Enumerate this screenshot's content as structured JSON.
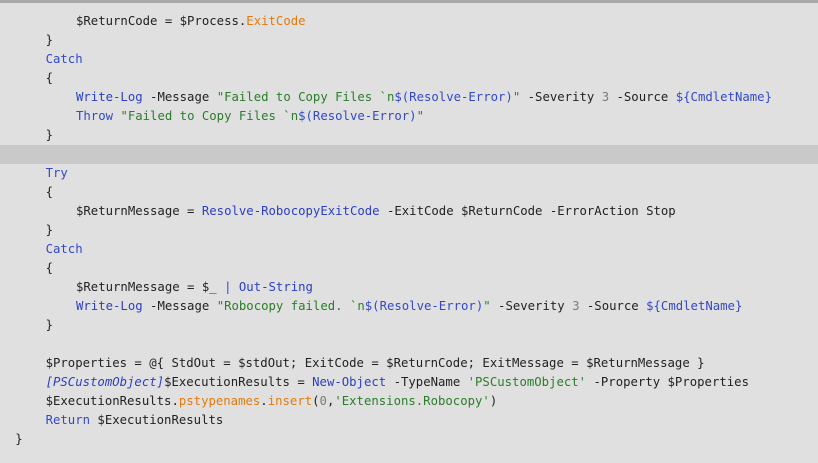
{
  "lines": [
    {
      "indent": 10,
      "tokens": [
        [
          "var",
          "$ReturnCode"
        ],
        [
          "plain",
          " = "
        ],
        [
          "var",
          "$Process"
        ],
        [
          "plain",
          "."
        ],
        [
          "prop",
          "ExitCode"
        ]
      ]
    },
    {
      "indent": 6,
      "tokens": [
        [
          "punc",
          "}"
        ]
      ]
    },
    {
      "indent": 6,
      "tokens": [
        [
          "kw",
          "Catch"
        ]
      ]
    },
    {
      "indent": 6,
      "tokens": [
        [
          "punc",
          "{"
        ]
      ]
    },
    {
      "indent": 10,
      "tokens": [
        [
          "cmd",
          "Write-Log"
        ],
        [
          "param",
          " -Message "
        ],
        [
          "str",
          "\"Failed to Copy Files `n"
        ],
        [
          "kw",
          "$(Resolve-Error)"
        ],
        [
          "str",
          "\""
        ],
        [
          "param",
          " -Severity "
        ],
        [
          "num",
          "3"
        ],
        [
          "param",
          " -Source "
        ],
        [
          "kw",
          "${CmdletName}"
        ]
      ]
    },
    {
      "indent": 10,
      "tokens": [
        [
          "kw",
          "Throw"
        ],
        [
          "plain",
          " "
        ],
        [
          "str",
          "\"Failed to Copy Files `n"
        ],
        [
          "kw",
          "$(Resolve-Error)"
        ],
        [
          "str",
          "\""
        ]
      ]
    },
    {
      "indent": 6,
      "tokens": [
        [
          "punc",
          "}"
        ]
      ]
    },
    {
      "indent": 0,
      "highlight": true,
      "tokens": []
    },
    {
      "indent": 6,
      "tokens": [
        [
          "kw",
          "Try"
        ]
      ]
    },
    {
      "indent": 6,
      "tokens": [
        [
          "punc",
          "{"
        ]
      ]
    },
    {
      "indent": 10,
      "tokens": [
        [
          "var",
          "$ReturnMessage"
        ],
        [
          "plain",
          " = "
        ],
        [
          "cmd",
          "Resolve-RobocopyExitCode"
        ],
        [
          "param",
          " -ExitCode "
        ],
        [
          "var",
          "$ReturnCode"
        ],
        [
          "param",
          " -ErrorAction "
        ],
        [
          "plain",
          "Stop"
        ]
      ]
    },
    {
      "indent": 6,
      "tokens": [
        [
          "punc",
          "}"
        ]
      ]
    },
    {
      "indent": 6,
      "tokens": [
        [
          "kw",
          "Catch"
        ]
      ]
    },
    {
      "indent": 6,
      "tokens": [
        [
          "punc",
          "{"
        ]
      ]
    },
    {
      "indent": 10,
      "tokens": [
        [
          "var",
          "$ReturnMessage"
        ],
        [
          "plain",
          " = "
        ],
        [
          "var",
          "$_"
        ],
        [
          "plain",
          " "
        ],
        [
          "op",
          "|"
        ],
        [
          "plain",
          " "
        ],
        [
          "cmd",
          "Out-String"
        ]
      ]
    },
    {
      "indent": 10,
      "tokens": [
        [
          "cmd",
          "Write-Log"
        ],
        [
          "param",
          " -Message "
        ],
        [
          "str",
          "\"Robocopy failed. `n"
        ],
        [
          "kw",
          "$(Resolve-Error)"
        ],
        [
          "str",
          "\""
        ],
        [
          "param",
          " -Severity "
        ],
        [
          "num",
          "3"
        ],
        [
          "param",
          " -Source "
        ],
        [
          "kw",
          "${CmdletName}"
        ]
      ]
    },
    {
      "indent": 6,
      "tokens": [
        [
          "punc",
          "}"
        ]
      ]
    },
    {
      "indent": 0,
      "tokens": []
    },
    {
      "indent": 6,
      "tokens": [
        [
          "var",
          "$Properties"
        ],
        [
          "plain",
          " = "
        ],
        [
          "plain",
          "@{ StdOut = "
        ],
        [
          "var",
          "$stdOut"
        ],
        [
          "plain",
          "; ExitCode = "
        ],
        [
          "var",
          "$ReturnCode"
        ],
        [
          "plain",
          "; ExitMessage = "
        ],
        [
          "var",
          "$ReturnMessage"
        ],
        [
          "plain",
          " }"
        ]
      ]
    },
    {
      "indent": 6,
      "tokens": [
        [
          "type",
          "[PSCustomObject]"
        ],
        [
          "var",
          "$ExecutionResults"
        ],
        [
          "plain",
          " = "
        ],
        [
          "cmd",
          "New-Object"
        ],
        [
          "param",
          " -TypeName "
        ],
        [
          "str",
          "'PSCustomObject'"
        ],
        [
          "param",
          " -Property "
        ],
        [
          "var",
          "$Properties"
        ]
      ]
    },
    {
      "indent": 6,
      "tokens": [
        [
          "var",
          "$ExecutionResults"
        ],
        [
          "plain",
          "."
        ],
        [
          "prop",
          "pstypenames"
        ],
        [
          "plain",
          "."
        ],
        [
          "prop",
          "insert"
        ],
        [
          "plain",
          "("
        ],
        [
          "num",
          "0"
        ],
        [
          "plain",
          ","
        ],
        [
          "str",
          "'Extensions.Robocopy'"
        ],
        [
          "plain",
          ")"
        ]
      ]
    },
    {
      "indent": 6,
      "tokens": [
        [
          "kw",
          "Return"
        ],
        [
          "plain",
          " "
        ],
        [
          "var",
          "$ExecutionResults"
        ]
      ]
    },
    {
      "indent": 2,
      "tokens": [
        [
          "punc",
          "}"
        ]
      ]
    }
  ],
  "colors": {
    "background": "#e0e0e0",
    "current_line_highlight": "#c9c9c9"
  }
}
